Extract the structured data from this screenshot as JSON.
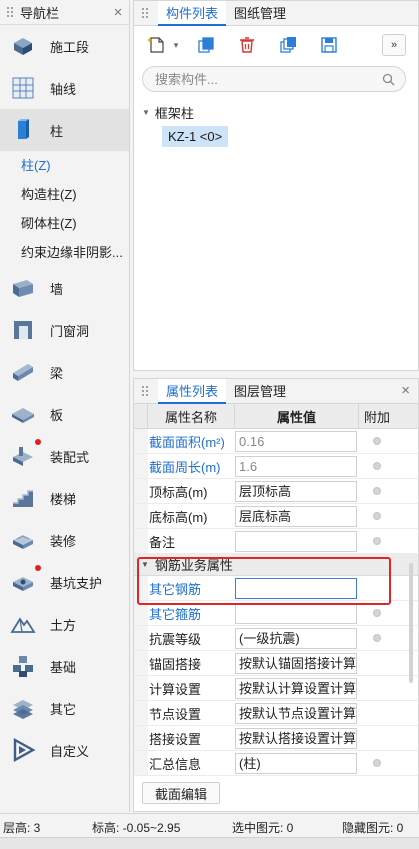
{
  "nav": {
    "title": "导航栏",
    "close": "×",
    "items_top": [
      {
        "label": "施工段",
        "icon": "construction-segment-icon"
      },
      {
        "label": "轴线",
        "icon": "axis-grid-icon"
      }
    ],
    "selected": {
      "label": "柱",
      "icon": "column-icon"
    },
    "sub_items": [
      "柱(Z)",
      "构造柱(Z)",
      "砌体柱(Z)",
      "约束边缘非阴影..."
    ],
    "items_bottom": [
      {
        "label": "墙",
        "icon": "wall-icon",
        "dot": false
      },
      {
        "label": "门窗洞",
        "icon": "door-window-icon",
        "dot": false
      },
      {
        "label": "梁",
        "icon": "beam-icon",
        "dot": false
      },
      {
        "label": "板",
        "icon": "slab-icon",
        "dot": false
      },
      {
        "label": "装配式",
        "icon": "prefab-icon",
        "dot": true
      },
      {
        "label": "楼梯",
        "icon": "stairs-icon",
        "dot": false
      },
      {
        "label": "装修",
        "icon": "decoration-icon",
        "dot": false
      },
      {
        "label": "基坑支护",
        "icon": "pit-support-icon",
        "dot": true
      },
      {
        "label": "土方",
        "icon": "earthwork-icon",
        "dot": false
      },
      {
        "label": "基础",
        "icon": "foundation-icon",
        "dot": false
      },
      {
        "label": "其它",
        "icon": "other-icon",
        "dot": false
      },
      {
        "label": "自定义",
        "icon": "custom-icon",
        "dot": false
      }
    ]
  },
  "component_panel": {
    "tabs": [
      "构件列表",
      "图纸管理"
    ],
    "active_tab": "构件列表",
    "search_placeholder": "搜索构件...",
    "tree": {
      "node": "框架柱",
      "leaf": "KZ-1 <0>"
    },
    "more": "»"
  },
  "property_panel": {
    "tabs": [
      "属性列表",
      "图层管理"
    ],
    "active_tab": "属性列表",
    "headers": {
      "name": "属性名称",
      "value": "属性值",
      "extra": "附加"
    },
    "rows_top": [
      {
        "name": "截面面积(m²)",
        "value": "0.16",
        "blue": true,
        "gray": true,
        "radio": true
      },
      {
        "name": "截面周长(m)",
        "value": "1.6",
        "blue": true,
        "gray": true,
        "radio": true
      },
      {
        "name": "顶标高(m)",
        "value": "层顶标高",
        "blue": false,
        "gray": false,
        "radio": true
      },
      {
        "name": "底标高(m)",
        "value": "层底标高",
        "blue": false,
        "gray": false,
        "radio": true
      },
      {
        "name": "备注",
        "value": "",
        "blue": false,
        "gray": false,
        "radio": true
      }
    ],
    "group": "钢筋业务属性",
    "rows_group": [
      {
        "name": "其它钢筋",
        "value": "",
        "blue": true,
        "focus": true,
        "radio": false
      },
      {
        "name": "其它箍筋",
        "value": "",
        "blue": true,
        "focus": false,
        "radio": true
      },
      {
        "name": "抗震等级",
        "value": "(一级抗震)",
        "blue": false,
        "focus": false,
        "radio": true
      },
      {
        "name": "锚固搭接",
        "value": "按默认锚固搭接计算",
        "blue": false,
        "focus": false,
        "radio": false
      },
      {
        "name": "计算设置",
        "value": "按默认计算设置计算",
        "blue": false,
        "focus": false,
        "radio": false
      },
      {
        "name": "节点设置",
        "value": "按默认节点设置计算",
        "blue": false,
        "focus": false,
        "radio": false
      },
      {
        "name": "搭接设置",
        "value": "按默认搭接设置计算",
        "blue": false,
        "focus": false,
        "radio": false
      },
      {
        "name": "汇总信息",
        "value": "(柱)",
        "blue": false,
        "focus": false,
        "radio": true
      }
    ],
    "edit_button": "截面编辑"
  },
  "status": {
    "floor": "层高: 3",
    "elevation": "标高: -0.05~2.95",
    "selected": "选中图元: 0",
    "hidden": "隐藏图元: 0"
  },
  "colors": {
    "accent": "#1e6fd1",
    "highlight": "#e02626",
    "dot": "#e02020"
  }
}
